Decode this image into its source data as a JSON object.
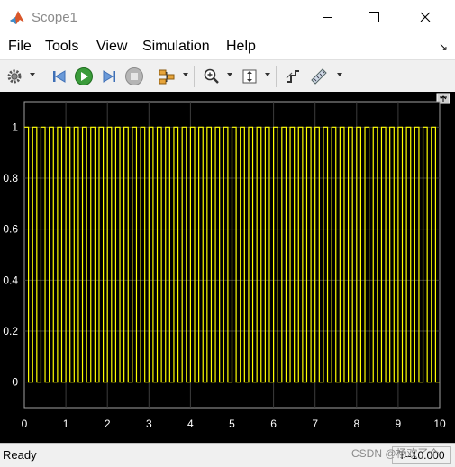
{
  "window": {
    "title": "Scope1",
    "controls": [
      "minimize-button",
      "maximize-button",
      "close-button"
    ]
  },
  "menu": {
    "items": [
      "File",
      "Tools",
      "View",
      "Simulation",
      "Help"
    ]
  },
  "toolbar": {
    "icons": [
      "gear-icon",
      "step-back-icon",
      "run-icon",
      "step-forward-icon",
      "stop-icon",
      "signal-selector-icon",
      "zoom-in-icon",
      "autoscale-icon",
      "signal-highlight-icon",
      "measure-icon"
    ]
  },
  "chart_data": {
    "type": "line",
    "xlim": [
      0,
      10
    ],
    "ylim": [
      -0.1,
      1.1
    ],
    "xticks": [
      "0",
      "1",
      "2",
      "3",
      "4",
      "5",
      "6",
      "7",
      "8",
      "9",
      "10"
    ],
    "yticks": [
      "0",
      "0.2",
      "0.4",
      "0.6",
      "0.8",
      "1"
    ],
    "grid": true,
    "series": [
      {
        "color": "#ffff00",
        "waveform": "square",
        "period": 0.2,
        "duty": 0.5,
        "low": 0,
        "high": 1,
        "x_start": 0,
        "x_end": 10
      }
    ]
  },
  "status": {
    "text": "Ready",
    "time": "T=10.000"
  },
  "watermark": "CSDN @杨欢了个"
}
